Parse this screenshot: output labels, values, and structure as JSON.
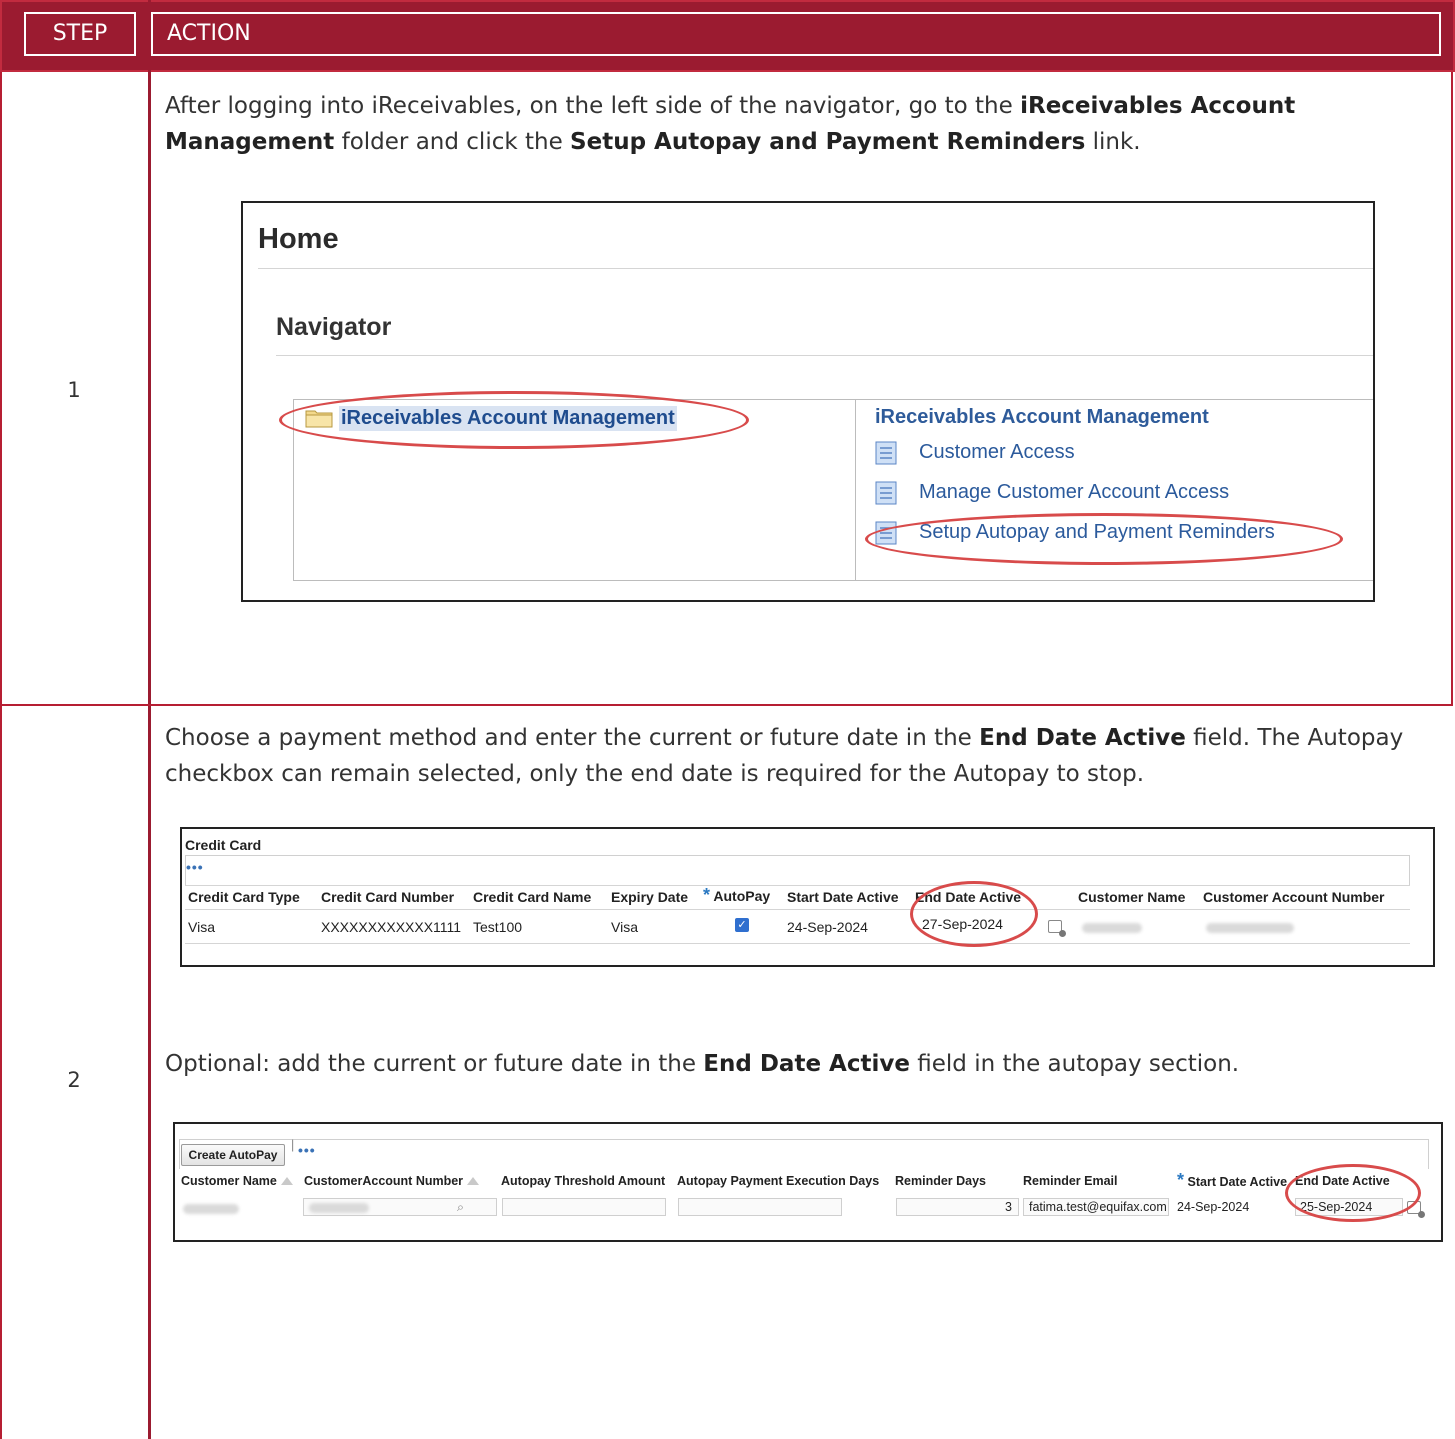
{
  "header": {
    "step_label": "STEP",
    "action_label": "ACTION"
  },
  "steps": [
    {
      "number": "1",
      "text_parts": [
        "After logging into iReceivables, on the left side of the navigator, go to the ",
        "iReceivables Account Management",
        " folder and click the ",
        "Setup Autopay and Payment Reminders",
        " link."
      ],
      "screenshot": {
        "home_title": "Home",
        "navigator_title": "Navigator",
        "folder_label": "iReceivables Account Management",
        "panel_heading": "iReceivables Account Management",
        "tasks": [
          "Customer Access",
          "Manage Customer Account Access",
          "Setup Autopay and Payment Reminders"
        ]
      }
    },
    {
      "number": "2",
      "text_parts": [
        "Choose a payment method and enter the current or future date in the ",
        "End Date Active",
        " field. The Autopay checkbox can remain selected, only the end date is required for the Autopay to stop."
      ],
      "credit_card": {
        "title": "Credit Card",
        "toolbar_dots": "•••",
        "columns": [
          "Credit Card Type",
          "Credit Card Number",
          "Credit Card Name",
          "Expiry Date",
          "AutoPay",
          "Start Date Active",
          "End Date Active",
          "Customer Name",
          "Customer Account Number"
        ],
        "required_mark": "*",
        "row": {
          "type": "Visa",
          "number": "XXXXXXXXXXXX1111",
          "name": "Test100",
          "expiry": "Visa",
          "autopay": true,
          "start": "24-Sep-2024",
          "end": "27-Sep-2024"
        }
      },
      "optional_parts": [
        "Optional: add the current or future date in the ",
        "End Date Active",
        " field in the autopay section."
      ],
      "autopay": {
        "button_label": "Create AutoPay",
        "separator": "|",
        "toolbar_dots": "•••",
        "columns": [
          "Customer Name",
          "CustomerAccount Number",
          "Autopay Threshold Amount",
          "Autopay Payment Execution Days",
          "Reminder Days",
          "Reminder Email",
          "Start Date Active",
          "End Date Active"
        ],
        "required_mark": "*",
        "row": {
          "reminder_days": "3",
          "reminder_email": "fatima.test@equifax.com",
          "start": "24-Sep-2024",
          "end": "25-Sep-2024"
        }
      }
    }
  ],
  "colors": {
    "header_bg": "#9b1b30",
    "border": "#b61e33",
    "highlight": "#d84b4b",
    "link": "#2b5a9c"
  }
}
